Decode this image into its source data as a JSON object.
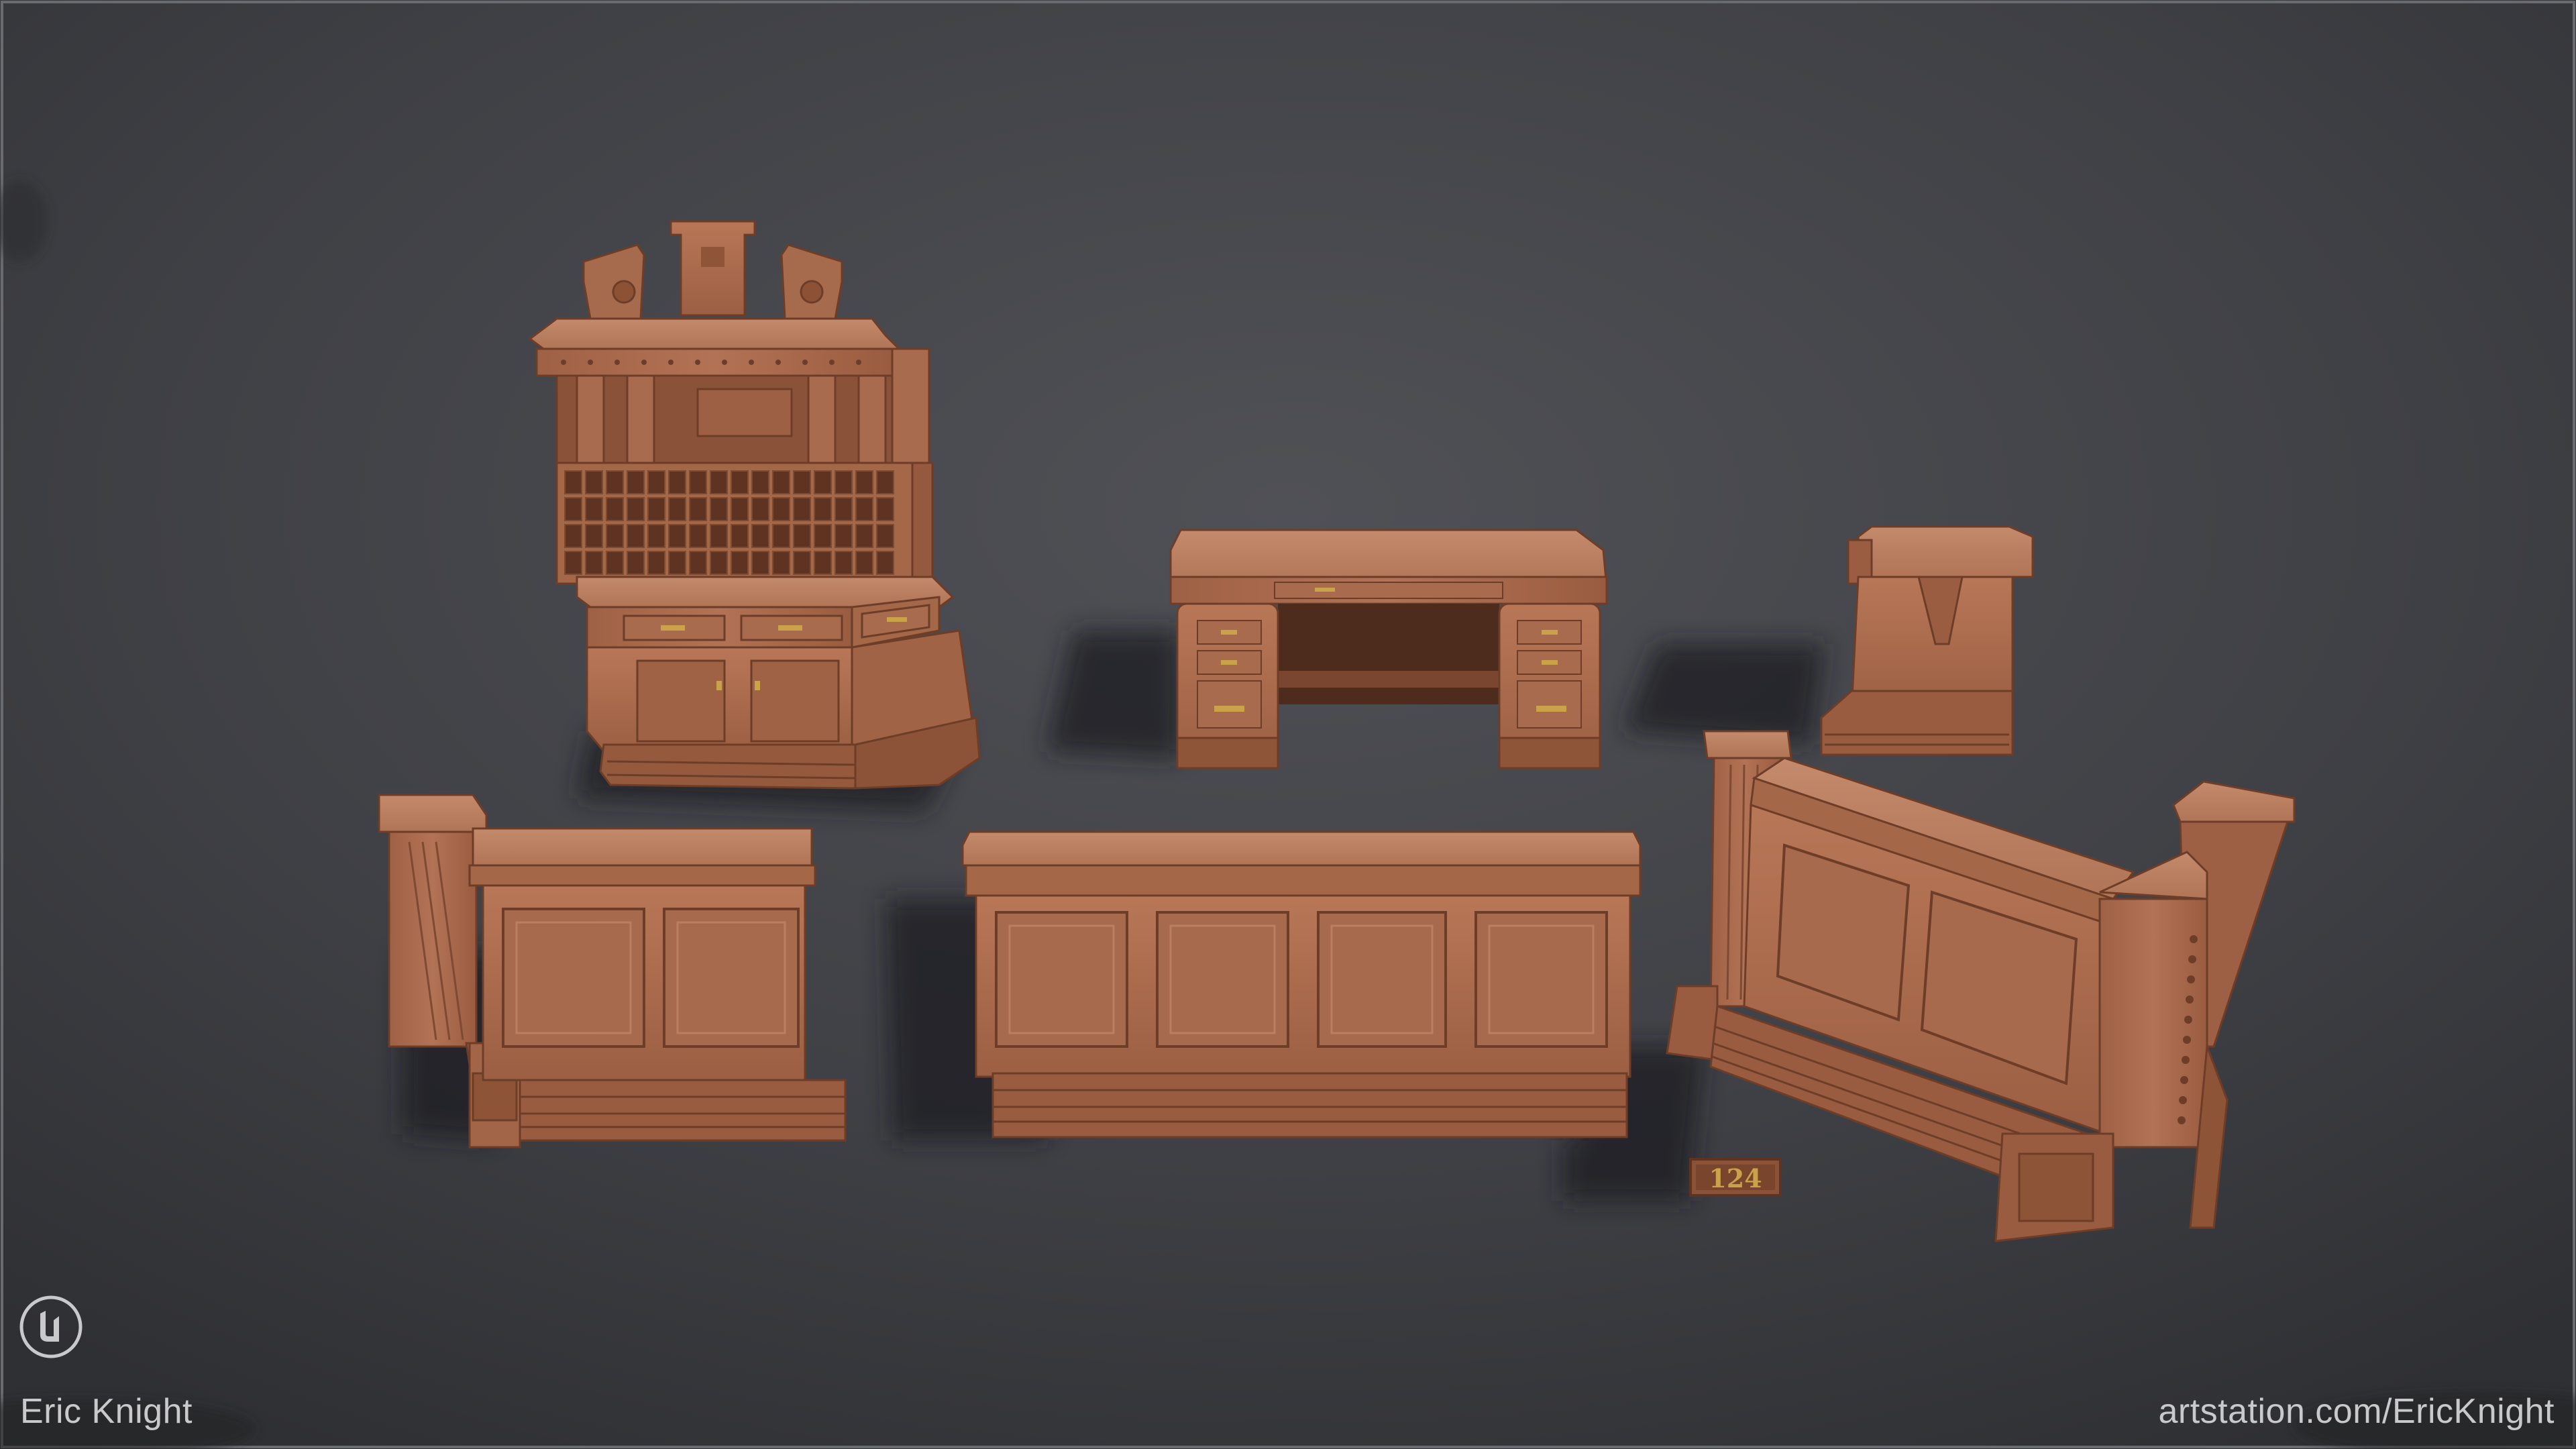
{
  "watermark": {
    "author": "Eric Knight",
    "site": "artstation.com/EricKnight"
  },
  "scene": {
    "plaque_number": "124"
  },
  "colors": {
    "background": "#3c3d42",
    "wood": "#a96a4d",
    "wood_dark": "#7a4630",
    "wood_light": "#c58a6b",
    "brass": "#c9a24a",
    "text": "#c9c9cc"
  },
  "icons": {
    "engine_logo": "unreal-engine-icon"
  }
}
